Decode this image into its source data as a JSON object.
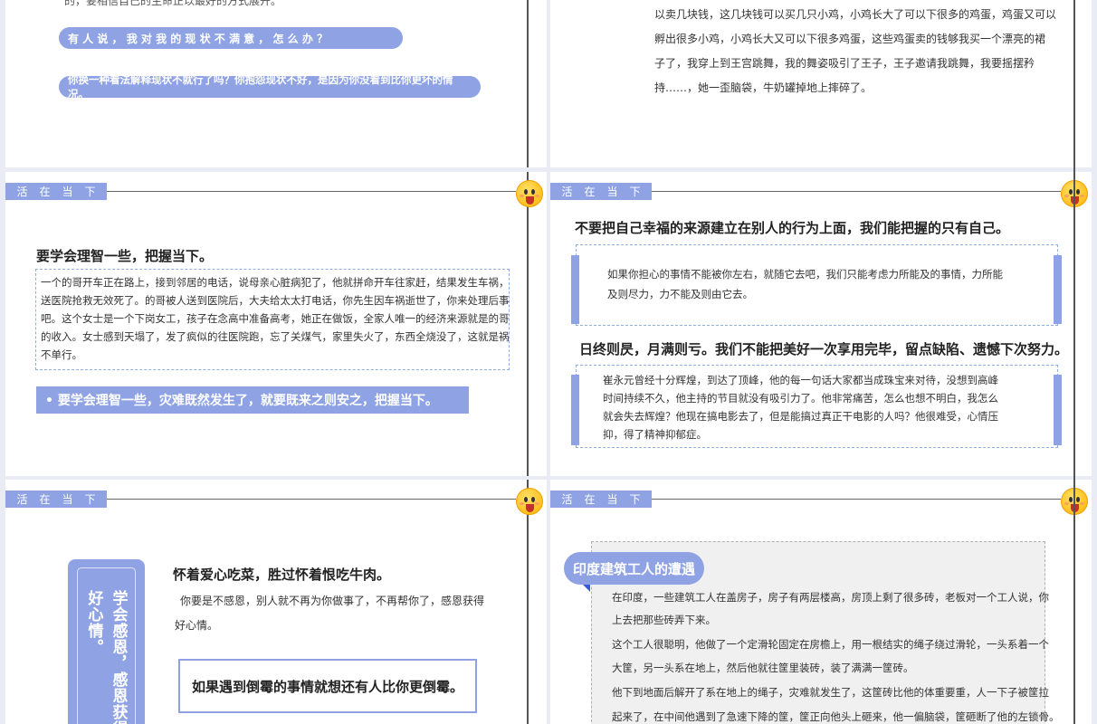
{
  "common": {
    "tag_chars": [
      "活",
      "在",
      "当",
      "下"
    ]
  },
  "s1": {
    "top_text": "的，要相信自己的生命正以最好的方式展开。",
    "q_pill": "有 人 说 ， 我 对 我 的 现 状 不 满 意 ， 怎 么 办 ？",
    "a_pill": "你换一种看法解释现状不就行了吗？你抱怨现状不好，是因为你没看到比你更坏的情况。"
  },
  "s2": {
    "lines": [
      "以卖几块钱，这几块钱可以买几只小鸡，小鸡长大了可以下很多的鸡蛋，鸡蛋又可以",
      "孵出很多小鸡，小鸡长大又可以下很多鸡蛋，这些鸡蛋卖的钱够我买一个漂亮的裙",
      "子了，我穿上到王宫跳舞，我的舞姿吸引了王子，王子邀请我跳舞，我要摇摆矜",
      "持……，她一歪脑袋，牛奶罐掉地上摔碎了。"
    ]
  },
  "s3": {
    "heading": "要学会理智一些，把握当下。",
    "lines": [
      "一个的哥开车正在路上，接到邻居的电话，说母亲心脏病犯了，他就拼命开车往家赶，结果发生车祸，",
      "送医院抢救无效死了。的哥被人送到医院后，大夫给太太打电话，你先生因车祸逝世了，你来处理后事",
      "吧。这个女士是一个下岗女工，孩子在念高中准备高考，她正在做饭，全家人唯一的经济来源就是的哥",
      "的收入。女士感到天塌了，发了疯似的往医院跑，忘了关煤气，家里失火了，东西全烧没了，这就是祸",
      "不单行。"
    ],
    "banner": "•  要学会理智一些，灾难既然发生了，就要既来之则安之，把握当下。"
  },
  "s4": {
    "heading1": "不要把自己幸福的来源建立在别人的行为上面，我们能把握的只有自己。",
    "box1": [
      "如果你担心的事情不能被你左右，就随它去吧，我们只能考虑力所能及的事情，力所能",
      "及则尽力，力不能及则由它去。"
    ],
    "heading2": "日终则昃，月满则亏。我们不能把美好一次享用完毕，留点缺陷、遗憾下次努力。",
    "box2": [
      "崔永元曾经十分辉煌，到达了顶峰，他的每一句话大家都当成珠宝来对待，没想到高峰",
      "时间持续不久，他主持的节目就没有吸引力了。他非常痛苦，怎么也想不明白，我怎么",
      "就会失去辉煌？他现在搞电影去了，但是能搞过真正干电影的人吗？他很难受，心情压",
      "抑，得了精神抑郁症。"
    ]
  },
  "s5": {
    "vertical_col1": "学会感恩，感恩获得",
    "vertical_col2": "好心情。",
    "heading": "怀着爱心吃菜，胜过怀着恨吃牛肉。",
    "lines": [
      "你要是不感恩，别人就不再为你做事了，不再帮你了，感恩获得",
      "好心情。"
    ],
    "box": "如果遇到倒霉的事情就想还有人比你更倒霉。"
  },
  "s6": {
    "title": "印度建筑工人的遭遇",
    "lines": [
      "在印度，一些建筑工人在盖房子，房子有两层楼高，房顶上剩了很多砖，老板对一个工人说，你",
      "上去把那些砖弄下来。",
      "这个工人很聪明，他做了一个定滑轮固定在房檐上，用一根结实的绳子绕过滑轮，一头系着一个",
      "大筐，另一头系在地上，然后他就往筐里装砖，装了满满一筐砖。",
      "他下到地面后解开了系在地上的绳子，灾难就发生了，这筐砖比他的体重要重，人一下子被筐拉",
      "起来了，在中间他遇到了急速下降的筐，筐正向他头上砸来，他一偏脑袋，筐砸断了他的左锁骨。"
    ]
  }
}
